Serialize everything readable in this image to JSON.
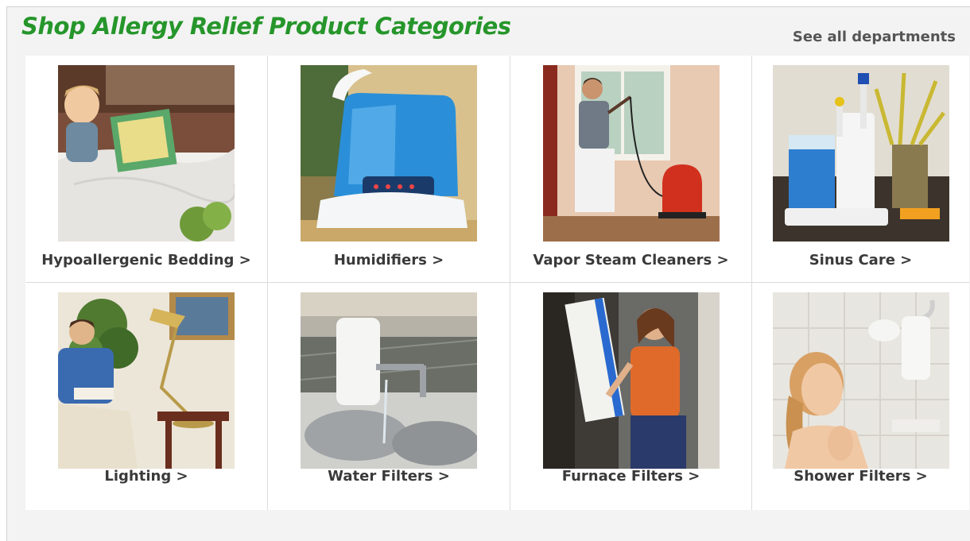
{
  "header": {
    "title": "Shop Allergy Relief Product Categories",
    "see_all": "See all departments"
  },
  "colors": {
    "title_green": "#26962b",
    "label_gray": "#3a3a3a",
    "panel_bg": "#f3f3f3"
  },
  "categories": [
    {
      "label": "Hypoallergenic Bedding >",
      "image": "child-reading-in-bed"
    },
    {
      "label": "Humidifiers >",
      "image": "blue-humidifier"
    },
    {
      "label": "Vapor Steam Cleaners >",
      "image": "woman-steam-cleaning-window"
    },
    {
      "label": "Sinus Care >",
      "image": "sinus-irrigation-device"
    },
    {
      "label": "Lighting >",
      "image": "man-reading-by-lamp"
    },
    {
      "label": "Water Filters >",
      "image": "faucet-water-filter"
    },
    {
      "label": "Furnace Filters >",
      "image": "woman-replacing-furnace-filter"
    },
    {
      "label": "Shower Filters >",
      "image": "woman-under-filtered-shower"
    }
  ]
}
